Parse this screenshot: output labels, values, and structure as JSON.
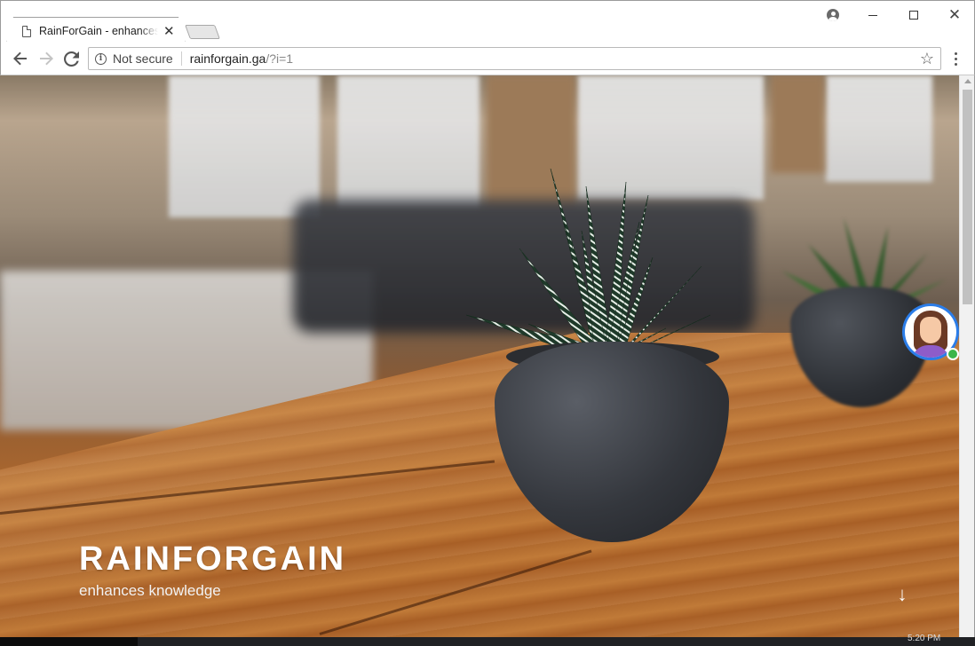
{
  "browser": {
    "tab": {
      "title": "RainForGain - enhances k",
      "close_glyph": "✕"
    },
    "window_controls": {
      "close_glyph": "✕"
    },
    "address": {
      "security_label": "Not secure",
      "host": "rainforgain.ga",
      "path": "/?i=1"
    },
    "icons": {
      "back": "arrow-left",
      "forward": "arrow-right",
      "reload": "reload",
      "bookmark": "star",
      "menu": "three-dots",
      "account": "user-circle"
    }
  },
  "page": {
    "hero": {
      "title": "RAINFORGAIN",
      "subtitle": "enhances knowledge",
      "scroll_glyph": "↓"
    }
  },
  "taskbar": {
    "clock": "5:20 PM"
  },
  "colors": {
    "accent_blue": "#2b7de9",
    "online_green": "#3bb54a",
    "hero_text": "#ffffff"
  }
}
